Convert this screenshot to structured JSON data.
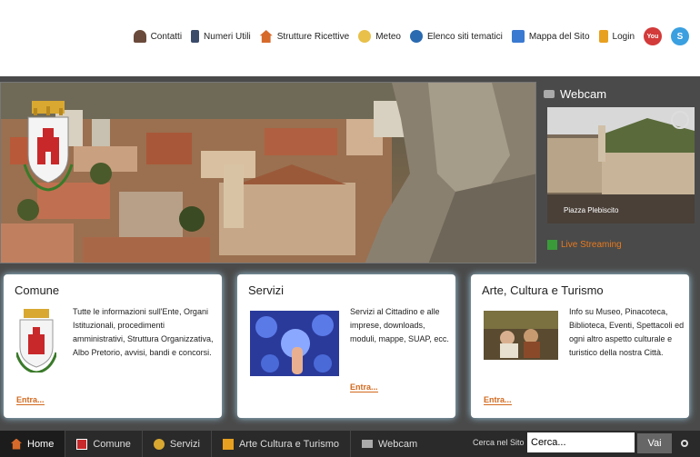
{
  "top_links": [
    {
      "label": "Contatti",
      "icon": "user-icon",
      "color": "#6a4a3a"
    },
    {
      "label": "Numeri Utili",
      "icon": "phone-icon",
      "color": "#3a4a6a"
    },
    {
      "label": "Strutture Ricettive",
      "icon": "house-icon",
      "color": "#d66a2a"
    },
    {
      "label": "Meteo",
      "icon": "weather-icon",
      "color": "#e8c04a"
    },
    {
      "label": "Elenco siti tematici",
      "icon": "globe-icon",
      "color": "#2a6ab0"
    },
    {
      "label": "Mappa del Sito",
      "icon": "map-icon",
      "color": "#3a7ad0"
    },
    {
      "label": "Login",
      "icon": "lock-icon",
      "color": "#e8a020"
    }
  ],
  "social": [
    {
      "label": "You",
      "icon": "youtube-icon",
      "color": "#d33a3a"
    },
    {
      "label": "S",
      "icon": "skype-icon",
      "color": "#3aa0e0"
    }
  ],
  "webcam": {
    "title": "Webcam",
    "caption": "Piazza Plebiscito",
    "streaming": "Live Streaming"
  },
  "cards": [
    {
      "title": "Comune",
      "text": "Tutte le informazioni sull'Ente, Organi Istituzionali, procedimenti amministrativi, Struttura Organizzativa, Albo Pretorio, avvisi, bandi e concorsi.",
      "link": "Entra..."
    },
    {
      "title": "Servizi",
      "text": "Servizi al Cittadino e alle imprese, downloads, moduli, mappe, SUAP, ecc.",
      "link": "Entra..."
    },
    {
      "title": "Arte, Cultura e Turismo",
      "text": "Info su Museo, Pinacoteca, Biblioteca, Eventi, Spettacoli ed ogni altro aspetto culturale e turistico della nostra Città.",
      "link": "Entra..."
    }
  ],
  "nav": [
    {
      "label": "Home",
      "icon": "home-icon"
    },
    {
      "label": "Comune",
      "icon": "comune-icon"
    },
    {
      "label": "Servizi",
      "icon": "servizi-icon"
    },
    {
      "label": "Arte Cultura e Turismo",
      "icon": "arte-icon"
    },
    {
      "label": "Webcam",
      "icon": "camera-icon"
    }
  ],
  "search": {
    "label": "Cerca nel Sito",
    "value": "Cerca...",
    "button": "Vai"
  }
}
